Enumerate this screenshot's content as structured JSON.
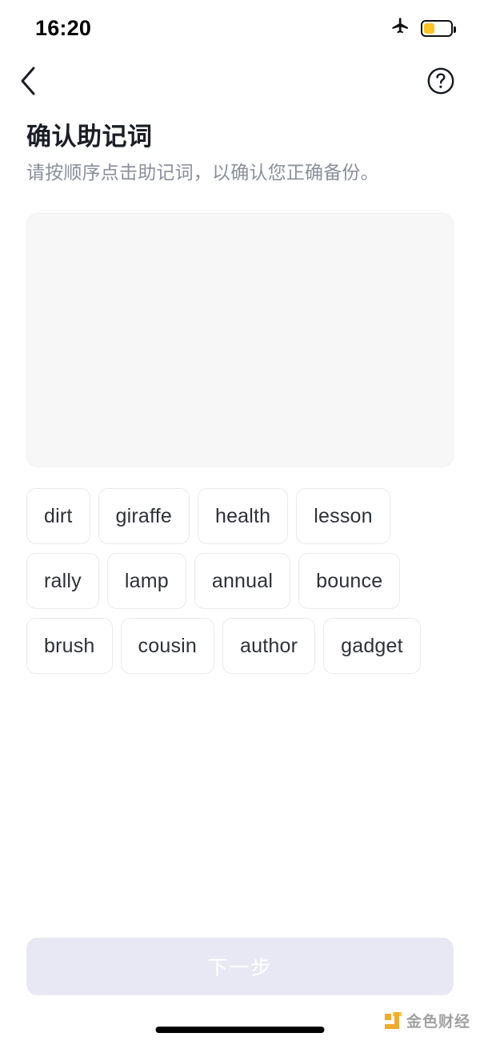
{
  "status_bar": {
    "time": "16:20",
    "airplane_icon": "airplane-icon",
    "battery_icon": "battery-low-power-icon",
    "battery_level_percent": 42,
    "battery_color": "#fcc521"
  },
  "nav": {
    "back_icon": "chevron-left-icon",
    "help_icon": "question-mark-circle-icon"
  },
  "header": {
    "title": "确认助记词",
    "subtitle": "请按顺序点击助记词，以确认您正确备份。"
  },
  "answer_panel": {
    "selected_words": [],
    "background_color": "#f7f7f8",
    "border_color": "#eeeff1"
  },
  "word_pool": {
    "words": [
      "dirt",
      "giraffe",
      "health",
      "lesson",
      "rally",
      "lamp",
      "annual",
      "bounce",
      "brush",
      "cousin",
      "author",
      "gadget"
    ],
    "chip_text_color": "#2e3138",
    "chip_border_color": "#e9eaec"
  },
  "footer": {
    "next_button_label": "下一步",
    "next_button_enabled": false,
    "next_button_color": "#e8e8f5",
    "watermark_text": "金色财经",
    "watermark_mark_color": "#f0a319",
    "home_indicator": "home-indicator"
  }
}
